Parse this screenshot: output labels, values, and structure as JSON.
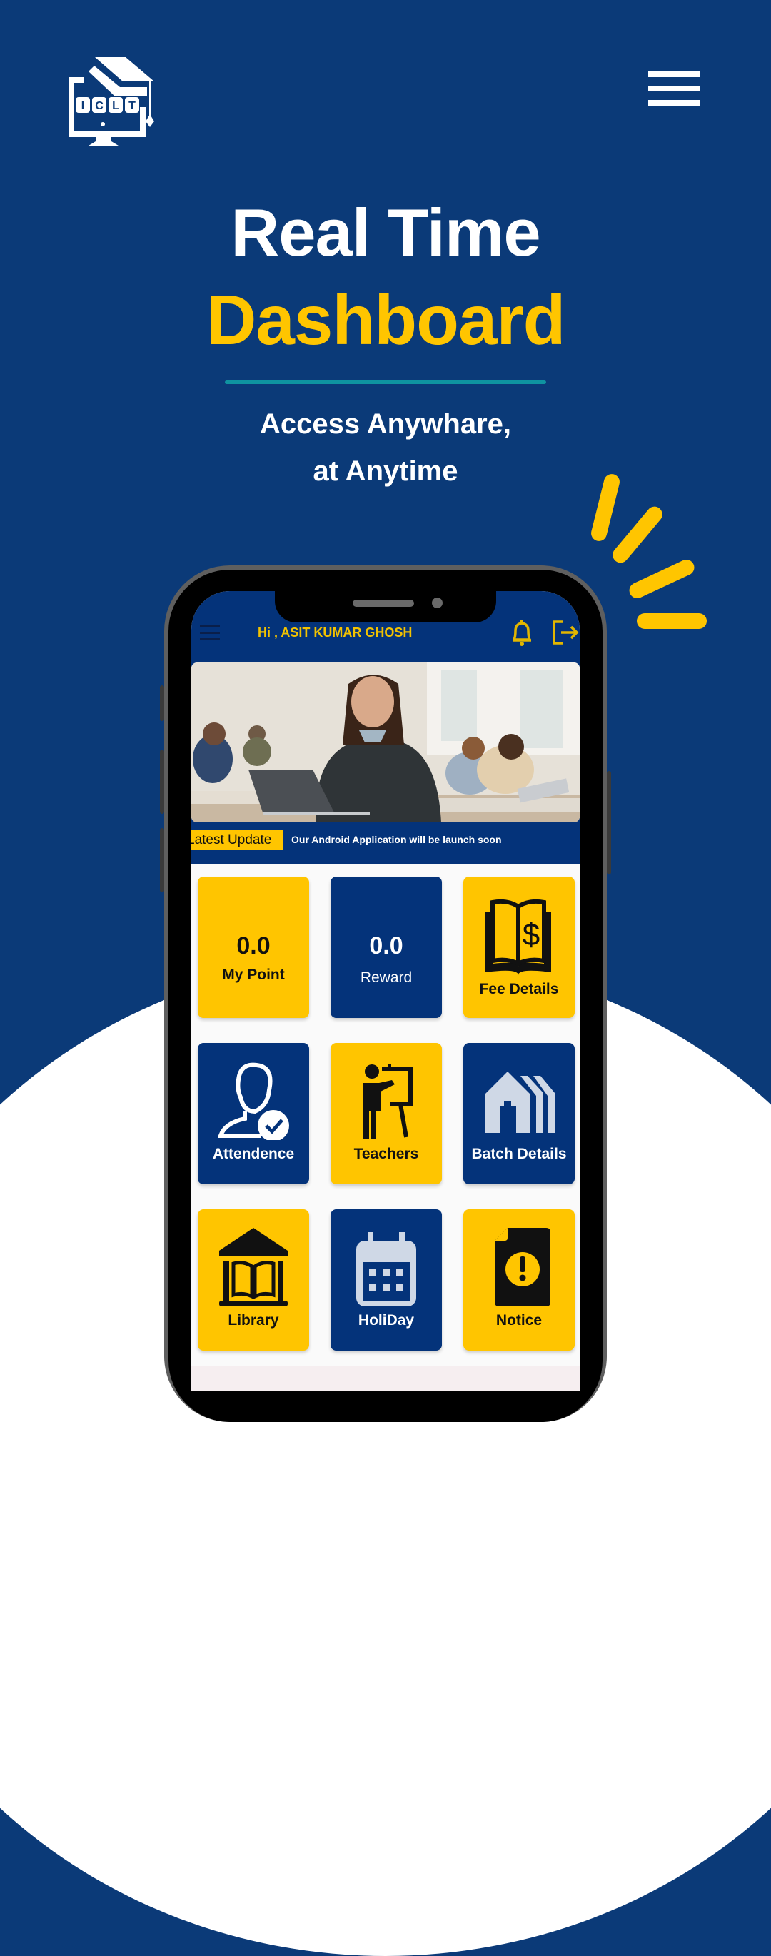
{
  "brand": {
    "logo_text": "ICLT",
    "accent_yellow": "#ffc500",
    "navy": "#0b3a78",
    "teal": "#0f93a0"
  },
  "hero": {
    "title_line1": "Real Time",
    "title_line2": "Dashboard",
    "subtitle_line1": "Access Anywhare,",
    "subtitle_line2": "at Anytime"
  },
  "app": {
    "greeting": "Hi , ASIT KUMAR GHOSH",
    "ticker_label": "Latest Update",
    "ticker_text": "Our Android Application will be launch soon",
    "tiles": [
      {
        "label": "My Point",
        "value": "0.0",
        "icon": "none",
        "style": "yellow"
      },
      {
        "label": "Reward",
        "value": "0.0",
        "icon": "none",
        "style": "navy"
      },
      {
        "label": "Fee Details",
        "icon": "book-dollar-icon",
        "style": "yellow"
      },
      {
        "label": "Attendence",
        "icon": "user-check-icon",
        "style": "navy"
      },
      {
        "label": "Teachers",
        "icon": "teacher-board-icon",
        "style": "yellow"
      },
      {
        "label": "Batch Details",
        "icon": "buildings-icon",
        "style": "navy"
      },
      {
        "label": "Library",
        "icon": "library-icon",
        "style": "yellow"
      },
      {
        "label": "HoliDay",
        "icon": "calendar-icon",
        "style": "navy"
      },
      {
        "label": "Notice",
        "icon": "notice-alert-icon",
        "style": "yellow"
      }
    ]
  }
}
